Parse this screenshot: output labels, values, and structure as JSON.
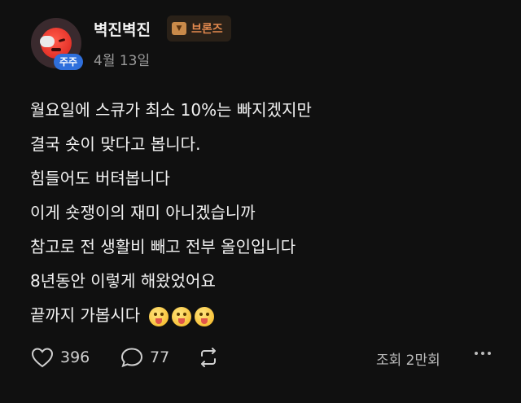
{
  "post": {
    "username": "벽진벽진",
    "rank_badge": {
      "label": "브론즈",
      "icon": "bronze-rank-icon"
    },
    "stock_tag": "주주",
    "date": "4월 13일",
    "lines": [
      "월요일에 스큐가 최소 10%는 빠지겠지만",
      "결국 숏이 맞다고 봅니다.",
      "힘들어도 버텨봅니다",
      "이게 숏쟁이의 재미 아니겠습니까",
      "참고로 전 생활비 빼고 전부 올인입니다",
      "8년동안 이렇게 해왔었어요",
      "끝까지 가봅시다"
    ],
    "emojis": [
      "grinning-squint-face",
      "tongue-out-face",
      "winking-tongue-face"
    ]
  },
  "actions": {
    "like_count": "396",
    "comment_count": "77",
    "views": "조회 2만회"
  },
  "colors": {
    "background": "#101010",
    "badge_bg": "#2a2118",
    "badge_text": "#e38a4f",
    "tag_bg": "#2f6fdc"
  }
}
